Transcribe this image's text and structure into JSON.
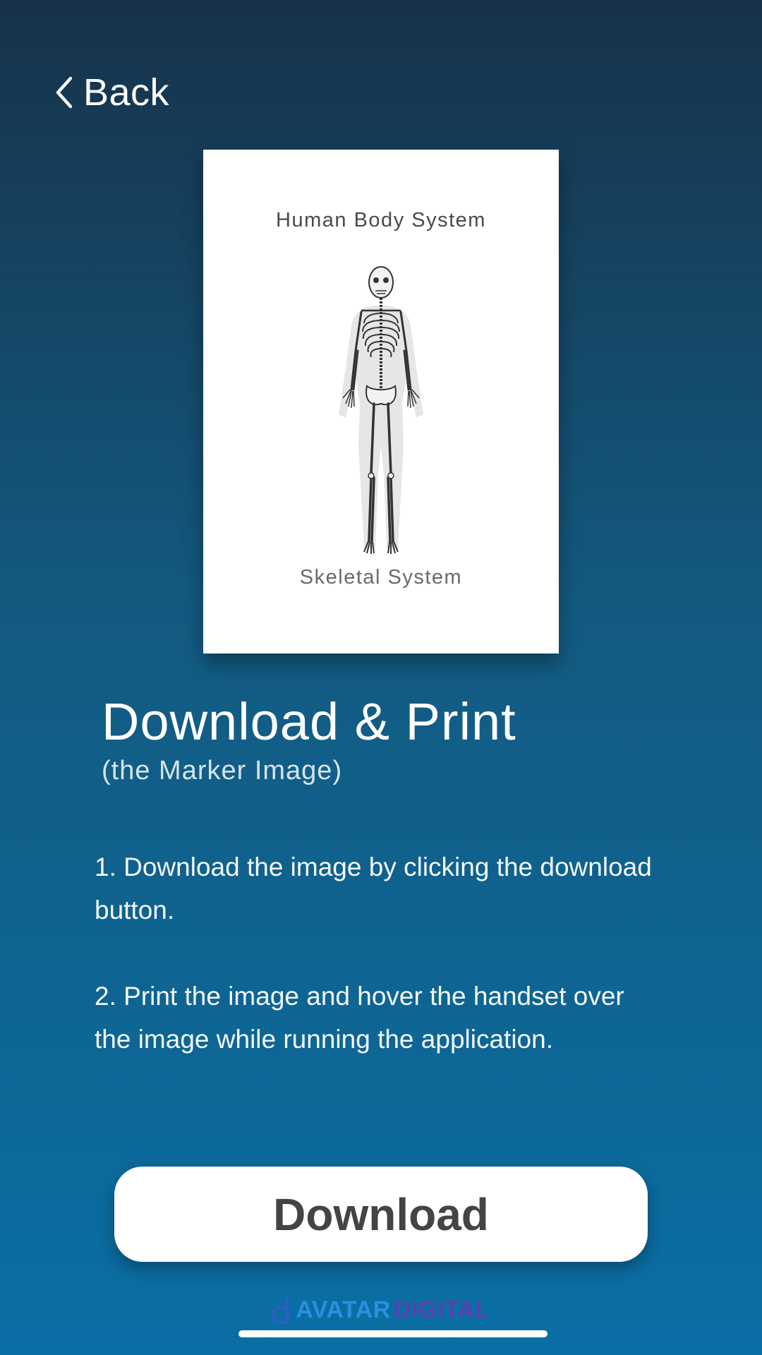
{
  "nav": {
    "back_label": "Back"
  },
  "marker_card": {
    "title": "Human Body System",
    "subtitle": "Skeletal System"
  },
  "main": {
    "heading": "Download & Print",
    "subheading": "(the Marker Image)",
    "instructions": [
      "1. Download the image by clicking the download button.",
      "2. Print the image and hover the handset over the image while running the application."
    ]
  },
  "actions": {
    "download_label": "Download"
  },
  "brand": {
    "word_1": "AVATAR",
    "word_2": "DIGITAL"
  },
  "colors": {
    "background_top": "#17324a",
    "background_bottom": "#0a6fa5",
    "button_background": "#ffffff",
    "button_text": "#444444"
  },
  "icons": {
    "back": "chevron-left-icon",
    "image": "skeleton-illustration",
    "logo": "avatar-digital-logo"
  }
}
